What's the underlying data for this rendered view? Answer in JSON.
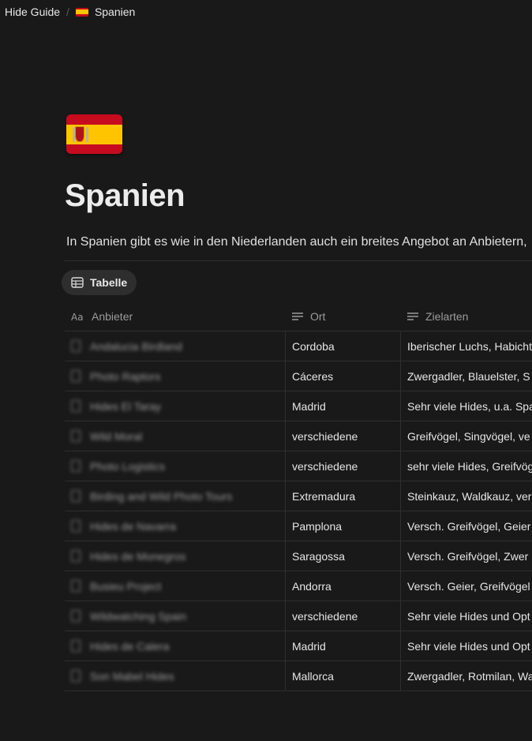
{
  "breadcrumb": {
    "root": "Hide Guide",
    "separator": "/",
    "current": "Spanien"
  },
  "page": {
    "icon": "spain-flag-icon",
    "title": "Spanien",
    "description": "In Spanien gibt es wie in den Niederlanden auch ein breites Angebot an Anbietern,"
  },
  "view": {
    "tab_label": "Tabelle"
  },
  "table": {
    "columns": [
      {
        "label": "Anbieter",
        "icon": "text-aa-icon"
      },
      {
        "label": "Ort",
        "icon": "text-lines-icon"
      },
      {
        "label": "Zielarten",
        "icon": "text-lines-icon"
      }
    ],
    "rows": [
      {
        "anbieter": "Andalucia Birdland",
        "ort": "Cordoba",
        "zielarten": "Iberischer Luchs, Habicht"
      },
      {
        "anbieter": "Photo Raptors",
        "ort": "Cáceres",
        "zielarten": "Zwergadler, Blauelster, S"
      },
      {
        "anbieter": "Hides El Taray",
        "ort": "Madrid",
        "zielarten": "Sehr viele Hides, u.a. Spa"
      },
      {
        "anbieter": "Wild Moral",
        "ort": "verschiedene",
        "zielarten": "Greifvögel, Singvögel, ve"
      },
      {
        "anbieter": "Photo Logistics",
        "ort": "verschiedene",
        "zielarten": "sehr viele Hides, Greifvög"
      },
      {
        "anbieter": "Birding and Wild Photo Tours",
        "ort": "Extremadura",
        "zielarten": "Steinkauz, Waldkauz, ver"
      },
      {
        "anbieter": "Hides de Navarra",
        "ort": "Pamplona",
        "zielarten": "Versch. Greifvögel, Geier"
      },
      {
        "anbieter": "Hides de Monegros",
        "ort": "Saragossa",
        "zielarten": "Versch. Greifvögel, Zwer"
      },
      {
        "anbieter": "Busieu Project",
        "ort": "Andorra",
        "zielarten": "Versch. Geier, Greifvögel"
      },
      {
        "anbieter": "Wildwatching Spain",
        "ort": "verschiedene",
        "zielarten": "Sehr viele Hides und Opt"
      },
      {
        "anbieter": "Hides de Calera",
        "ort": "Madrid",
        "zielarten": "Sehr viele Hides und Opt"
      },
      {
        "anbieter": "Son Mabel Hides",
        "ort": "Mallorca",
        "zielarten": "Zwergadler, Rotmilan, Wa"
      }
    ]
  },
  "colors": {
    "background": "#191919",
    "text": "#e6e6e6",
    "muted": "#9b9b9b",
    "divider": "#2f2f2f",
    "tab_bg": "#2e2e2e"
  }
}
